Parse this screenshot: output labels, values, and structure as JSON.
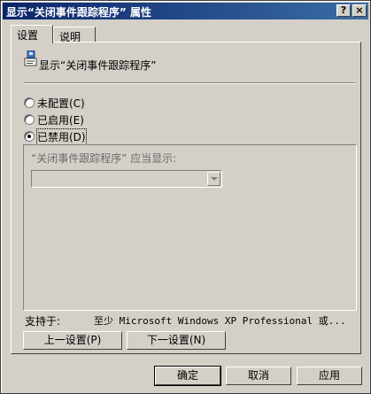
{
  "window": {
    "title": "显示“关闭事件跟踪程序” 属性",
    "help_button": "?",
    "close_button": "×"
  },
  "tabs": [
    {
      "label": "设置",
      "active": true
    },
    {
      "label": "说明",
      "active": false
    }
  ],
  "policy": {
    "icon": "policy-setting-icon",
    "name": "显示“关闭事件跟踪程序”"
  },
  "options": [
    {
      "label": "未配置(C)",
      "checked": false
    },
    {
      "label": "已启用(E)",
      "checked": false
    },
    {
      "label": "已禁用(D)",
      "checked": true
    }
  ],
  "group": {
    "label": "“关闭事件跟踪程序” 应当显示:",
    "combo_value": ""
  },
  "supports": {
    "label": "支持于:",
    "value": "至少 Microsoft Windows XP Professional 或..."
  },
  "nav": {
    "prev": "上一设置(P)",
    "next": "下一设置(N)"
  },
  "footer": {
    "ok": "确定",
    "cancel": "取消",
    "apply": "应用"
  }
}
